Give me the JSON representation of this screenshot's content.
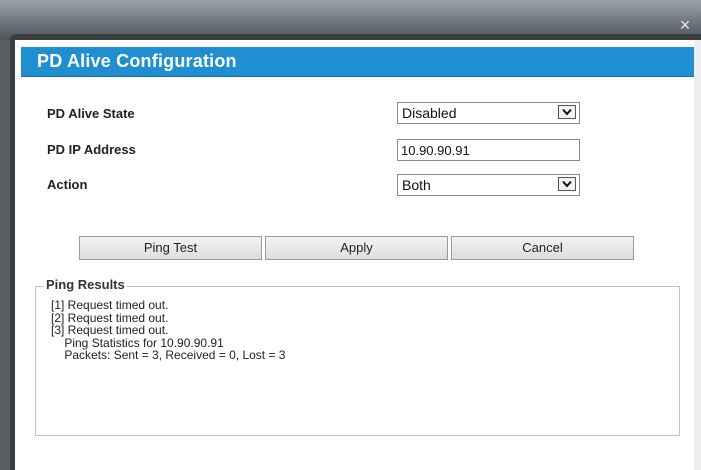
{
  "dialog": {
    "title": "PD Alive Configuration",
    "close_symbol": "×"
  },
  "form": {
    "alive_state": {
      "label": "PD Alive State",
      "value": "Disabled"
    },
    "ip_address": {
      "label": "PD IP Address",
      "value": "10.90.90.91"
    },
    "action": {
      "label": "Action",
      "value": "Both"
    }
  },
  "buttons": {
    "ping_test": "Ping Test",
    "apply": "Apply",
    "cancel": "Cancel"
  },
  "ping_results": {
    "legend": "Ping Results",
    "lines": [
      "[1] Request timed out.",
      "[2] Request timed out.",
      "[3] Request timed out.",
      "    Ping Statistics for 10.90.90.91",
      "    Packets: Sent = 3, Received = 0, Lost = 3"
    ]
  },
  "icons": {
    "close": "close-icon",
    "dropdown": "chevron-down-icon"
  },
  "colors": {
    "header": "#1f8fd1",
    "backdrop": "#6b6f74"
  }
}
